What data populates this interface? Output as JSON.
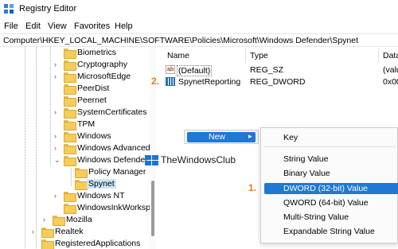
{
  "window": {
    "title": "Registry Editor"
  },
  "menu": [
    "File",
    "Edit",
    "View",
    "Favorites",
    "Help"
  ],
  "address": "Computer\\HKEY_LOCAL_MACHINE\\SOFTWARE\\Policies\\Microsoft\\Windows Defender\\Spynet",
  "tree": [
    {
      "label": "Biometrics",
      "expander": ""
    },
    {
      "label": "Cryptography",
      "expander": ">"
    },
    {
      "label": "MicrosoftEdge",
      "expander": ">"
    },
    {
      "label": "PeerDist",
      "expander": ""
    },
    {
      "label": "Peernet",
      "expander": ""
    },
    {
      "label": "SystemCertificates",
      "expander": ">"
    },
    {
      "label": "TPM",
      "expander": ""
    },
    {
      "label": "Windows",
      "expander": ">"
    },
    {
      "label": "Windows Advanced",
      "expander": ">"
    },
    {
      "label": "Windows Defender",
      "expander": "v"
    },
    {
      "label": "Policy Manager",
      "expander": ""
    },
    {
      "label": "Spynet",
      "expander": ""
    },
    {
      "label": "Windows NT",
      "expander": ">"
    },
    {
      "label": "WindowsInkWorkspace",
      "expander": ""
    },
    {
      "label": "Mozilla",
      "expander": ">"
    },
    {
      "label": "Realtek",
      "expander": ">"
    },
    {
      "label": "RegisteredApplications",
      "expander": ""
    }
  ],
  "list": {
    "columns": [
      "Name",
      "Type",
      "Data"
    ],
    "rows": [
      {
        "name": "(Default)",
        "type": "REG_SZ",
        "data": "(valu",
        "icon": "reg-sz-icon"
      },
      {
        "name": "SpynetReporting",
        "type": "REG_DWORD",
        "data": "0x00",
        "icon": "reg-dword-icon"
      }
    ]
  },
  "context_menu": {
    "new_label": "New",
    "submenu": [
      "Key",
      "String Value",
      "Binary Value",
      "DWORD (32-bit) Value",
      "QWORD (64-bit) Value",
      "Multi-String Value",
      "Expandable String Value"
    ],
    "highlighted_item": "DWORD (32-bit) Value"
  },
  "annotations": {
    "step1": "1.",
    "step2": "2."
  },
  "watermark": "TheWindowsClub",
  "colors": {
    "accent": "#1f78d1",
    "annotation": "#f07b1a",
    "selection": "#cce4f7"
  }
}
